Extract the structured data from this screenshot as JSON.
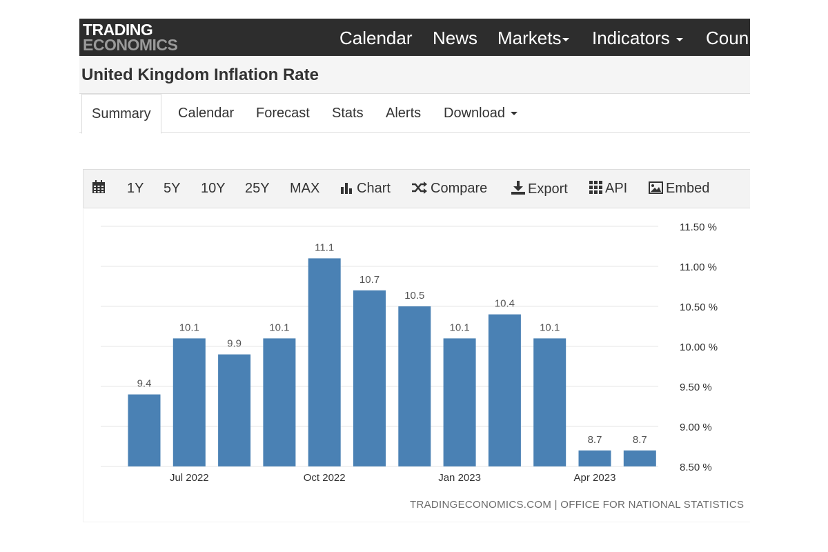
{
  "brand": {
    "line1": "TRADING",
    "line2": "ECONOMICS"
  },
  "nav": [
    {
      "label": "Calendar"
    },
    {
      "label": "News"
    },
    {
      "label": "Markets"
    },
    {
      "label": "Indicators"
    },
    {
      "label": "Coun"
    }
  ],
  "page": {
    "title": "United Kingdom Inflation Rate"
  },
  "tabs": [
    {
      "label": "Summary",
      "active": true
    },
    {
      "label": "Calendar"
    },
    {
      "label": "Forecast"
    },
    {
      "label": "Stats"
    },
    {
      "label": "Alerts"
    },
    {
      "label": "Download"
    }
  ],
  "toolbar": {
    "icons": {
      "calendar": "calendar-icon"
    },
    "ranges": [
      "1Y",
      "5Y",
      "10Y",
      "25Y",
      "MAX"
    ],
    "actions": [
      {
        "label": "Chart",
        "icon": "bar-chart-icon"
      },
      {
        "label": "Compare",
        "icon": "shuffle-icon"
      },
      {
        "label": "Export",
        "icon": "download-icon"
      },
      {
        "label": "API",
        "icon": "grid-icon"
      },
      {
        "label": "Embed",
        "icon": "image-icon"
      }
    ]
  },
  "chart_data": {
    "type": "bar",
    "values": [
      9.4,
      10.1,
      9.9,
      10.1,
      11.1,
      10.7,
      10.5,
      10.1,
      10.4,
      10.1,
      8.7,
      8.7
    ],
    "data_labels": [
      "9.4",
      "10.1",
      "9.9",
      "10.1",
      "11.1",
      "10.7",
      "10.5",
      "10.1",
      "10.4",
      "10.1",
      "8.7",
      "8.7"
    ],
    "x_ticks": [
      {
        "label": "Jul 2022",
        "index": 1
      },
      {
        "label": "Oct 2022",
        "index": 4
      },
      {
        "label": "Jan 2023",
        "index": 7
      },
      {
        "label": "Apr 2023",
        "index": 10
      }
    ],
    "y_ticks": [
      {
        "value": 8.5,
        "label": "8.50 %"
      },
      {
        "value": 9.0,
        "label": "9.00 %"
      },
      {
        "value": 9.5,
        "label": "9.50 %"
      },
      {
        "value": 10.0,
        "label": "10.00 %"
      },
      {
        "value": 10.5,
        "label": "10.50 %"
      },
      {
        "value": 11.0,
        "label": "11.00 %"
      },
      {
        "value": 11.5,
        "label": "11.50 %"
      }
    ],
    "ylim": [
      8.5,
      11.5
    ],
    "grid": true,
    "color": "#4a81b4"
  },
  "source": "TRADINGECONOMICS.COM | OFFICE FOR NATIONAL STATISTICS"
}
